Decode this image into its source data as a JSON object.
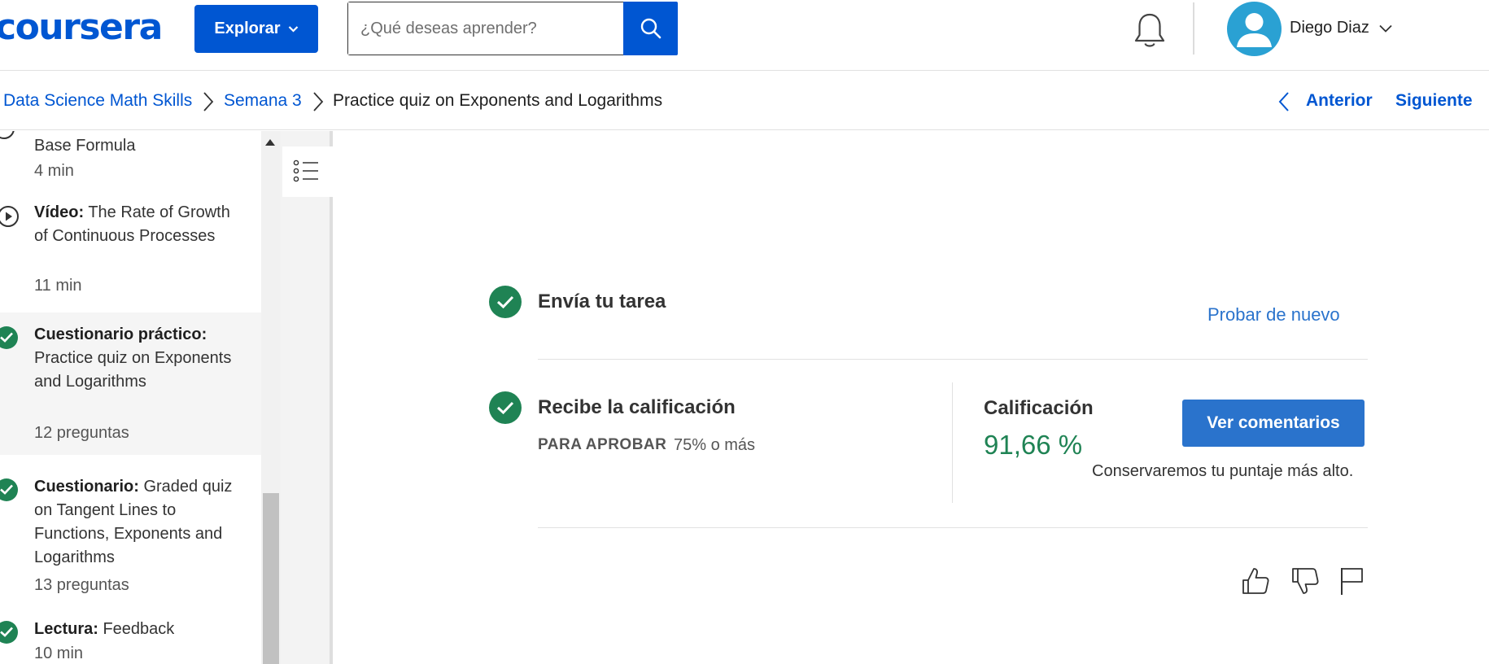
{
  "header": {
    "logo": "coursera",
    "explore_label": "Explorar",
    "search_placeholder": "¿Qué deseas aprender?",
    "user_name": "Diego Diaz"
  },
  "breadcrumb": {
    "items": [
      "Data Science Math Skills",
      "Semana 3",
      "Practice quiz on Exponents and Logarithms"
    ],
    "prev_label": "Anterior",
    "next_label": "Siguiente"
  },
  "sidebar": {
    "items": [
      {
        "type": "",
        "title": "Base Formula",
        "meta": "4 min",
        "status": "partial"
      },
      {
        "type": "Vídeo:",
        "title": "The Rate of Growth of Continuous Processes",
        "meta": "11 min",
        "status": "video"
      },
      {
        "type": "Cuestionario práctico:",
        "title": "Practice quiz on Exponents and Logarithms",
        "meta": "12 preguntas",
        "status": "done",
        "active": true
      },
      {
        "type": "Cuestionario:",
        "title": "Graded quiz on Tangent Lines to Functions, Exponents and Logarithms",
        "meta": "13 preguntas",
        "status": "done"
      },
      {
        "type": "Lectura:",
        "title": "Feedback",
        "meta": "10 min",
        "status": "done"
      }
    ]
  },
  "main": {
    "submit_title": "Envía tu tarea",
    "retry_label": "Probar de nuevo",
    "grade_title": "Recibe la calificación",
    "pass_label": "PARA APROBAR",
    "pass_value": "75% o más",
    "grade_label": "Calificación",
    "grade_value": "91,66 %",
    "feedback_button": "Ver comentarios",
    "keep_note": "Conservaremos tu puntaje más alto."
  },
  "colors": {
    "brand": "#0056d2",
    "success": "#1f8354",
    "action": "#2a73cc"
  }
}
